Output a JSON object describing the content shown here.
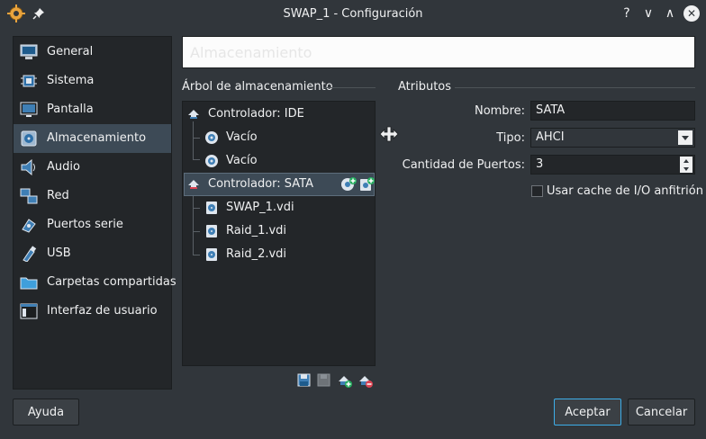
{
  "window": {
    "title": "SWAP_1 - Configuración",
    "help_glyph": "?",
    "minimize_glyph": "∨",
    "maximize_glyph": "∧",
    "close_glyph": "✕"
  },
  "sidebar": {
    "items": [
      {
        "label": "General",
        "icon": "monitor-general-icon"
      },
      {
        "label": "Sistema",
        "icon": "chip-icon"
      },
      {
        "label": "Pantalla",
        "icon": "display-icon"
      },
      {
        "label": "Almacenamiento",
        "icon": "hard-disk-icon",
        "selected": true
      },
      {
        "label": "Audio",
        "icon": "speaker-icon"
      },
      {
        "label": "Red",
        "icon": "network-icon"
      },
      {
        "label": "Puertos serie",
        "icon": "serial-port-icon"
      },
      {
        "label": "USB",
        "icon": "usb-icon"
      },
      {
        "label": "Carpetas compartidas",
        "icon": "shared-folder-icon"
      },
      {
        "label": "Interfaz de usuario",
        "icon": "user-interface-icon"
      }
    ]
  },
  "header": {
    "title": "Almacenamiento"
  },
  "storage_tree": {
    "title": "Árbol de almacenamiento",
    "rows": [
      {
        "label": "Controlador: IDE",
        "type": "controller"
      },
      {
        "label": "Vacío",
        "type": "optical"
      },
      {
        "label": "Vacío",
        "type": "optical"
      },
      {
        "label": "Controlador: SATA",
        "type": "controller",
        "selected": true
      },
      {
        "label": "SWAP_1.vdi",
        "type": "disk"
      },
      {
        "label": "Raid_1.vdi",
        "type": "disk"
      },
      {
        "label": "Raid_2.vdi",
        "type": "disk"
      }
    ]
  },
  "attributes": {
    "title": "Atributos",
    "name_label": "Nombre:",
    "name_value": "SATA",
    "type_label": "Tipo:",
    "type_value": "AHCI",
    "ports_label": "Cantidad de Puertos:",
    "ports_value": "3",
    "cache_label": "Usar cache de I/O anfitrión",
    "cache_checked": false
  },
  "buttons": {
    "help": "Ayuda",
    "accept": "Aceptar",
    "cancel": "Cancelar"
  },
  "colors": {
    "background": "#31363b",
    "panel": "#232629",
    "selection": "#3d4a56",
    "accent": "#3daee9"
  }
}
